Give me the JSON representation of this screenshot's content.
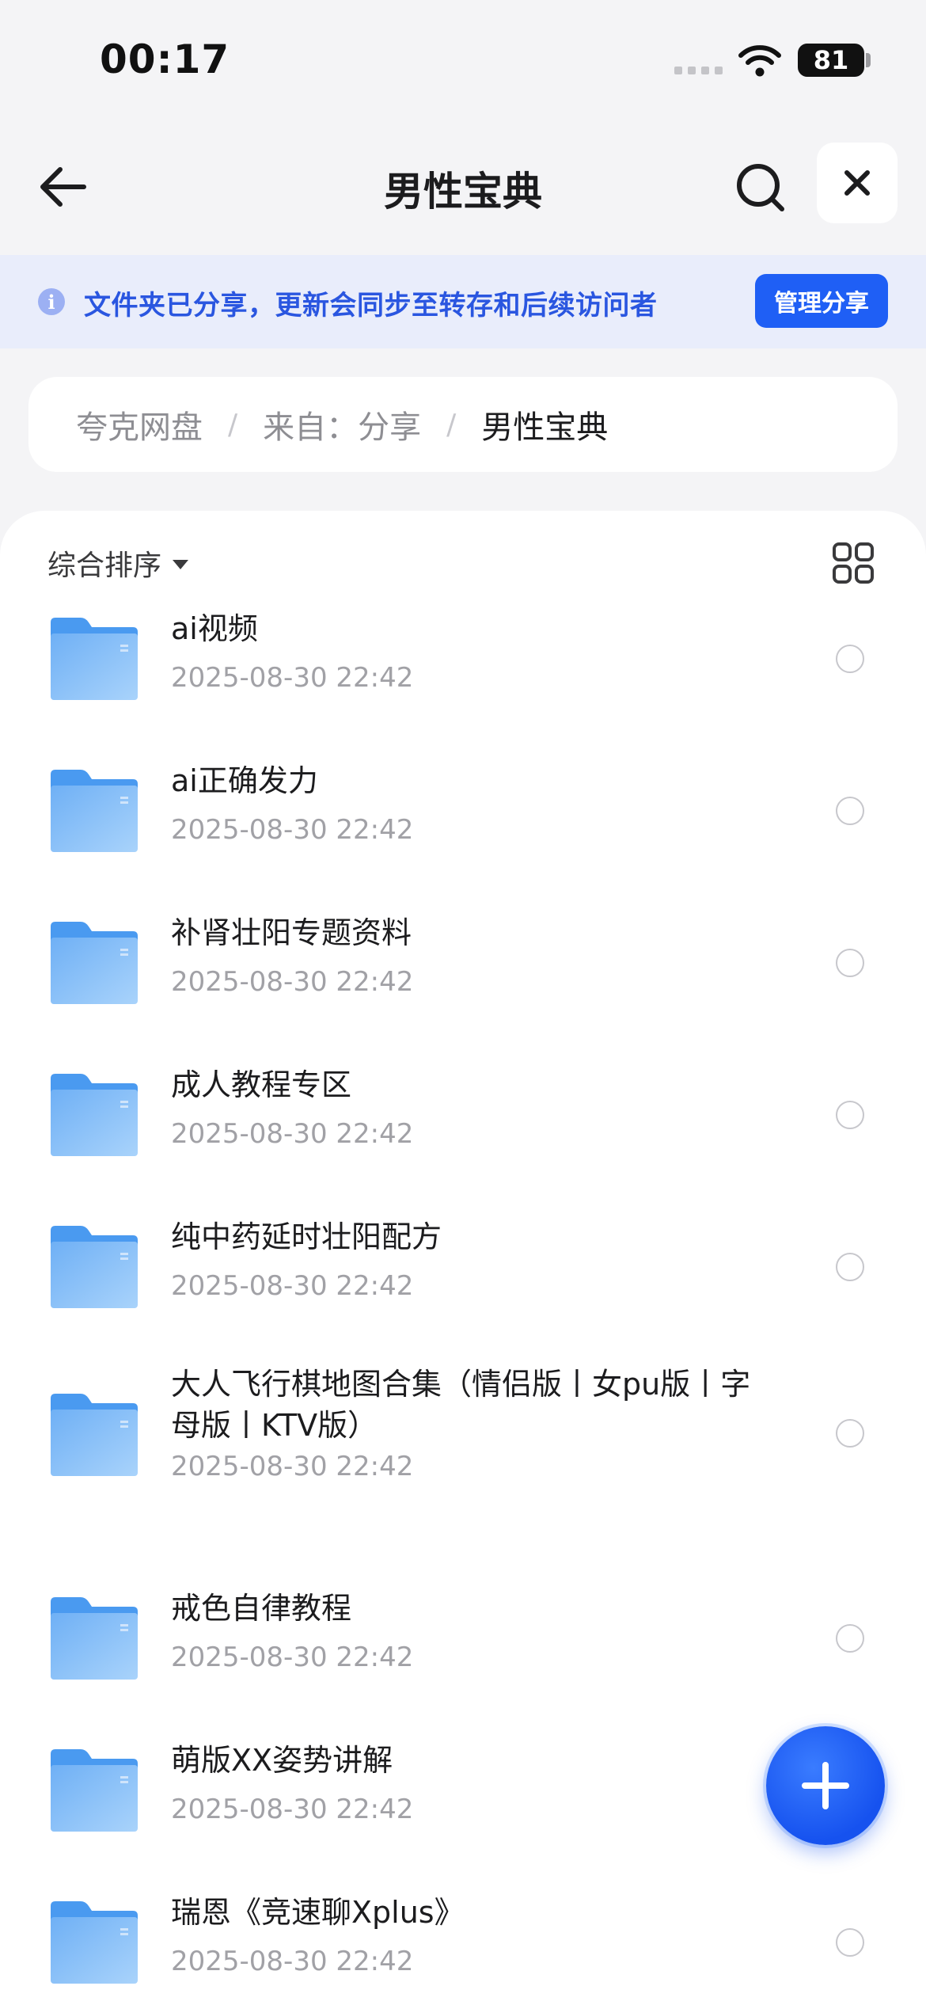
{
  "status_bar": {
    "time": "00:17",
    "battery": "81"
  },
  "nav": {
    "title": "男性宝典"
  },
  "share_banner": {
    "text": "文件夹已分享，更新会同步至转存和后续访问者",
    "manage_button": "管理分享",
    "info_icon_glyph": "i"
  },
  "breadcrumb": {
    "items": [
      "夸克网盘",
      "来自：分享"
    ],
    "separator": "/",
    "current": "男性宝典"
  },
  "toolbar": {
    "sort_label": "综合排序"
  },
  "files": [
    {
      "name": "ai视频",
      "date": "2025-08-30 22:42"
    },
    {
      "name": "ai正确发力",
      "date": "2025-08-30 22:42"
    },
    {
      "name": "补肾壮阳专题资料",
      "date": "2025-08-30 22:42"
    },
    {
      "name": "成人教程专区",
      "date": "2025-08-30 22:42"
    },
    {
      "name": "纯中药延时壮阳配方",
      "date": "2025-08-30 22:42"
    },
    {
      "name": "大人飞行棋地图合集（情侣版丨女pu版丨字母版丨KTV版）",
      "date": "2025-08-30 22:42"
    },
    {
      "name": "戒色自律教程",
      "date": "2025-08-30 22:42"
    },
    {
      "name": "萌版XX姿势讲解",
      "date": "2025-08-30 22:42"
    },
    {
      "name": "瑞恩《竞速聊Xplus》",
      "date": "2025-08-30 22:42"
    }
  ],
  "colors": {
    "accent": "#1f5ff5",
    "banner_bg": "#e9edfb",
    "banner_text": "#2a56e0",
    "folder_top": "#4a9af0",
    "folder_body": "#8cc3f8"
  },
  "icons": {
    "back": "arrow-left-icon",
    "search": "search-icon",
    "close": "close-icon",
    "info": "info-icon",
    "grid": "grid-view-icon",
    "folder": "folder-icon",
    "fab": "plus-icon"
  }
}
